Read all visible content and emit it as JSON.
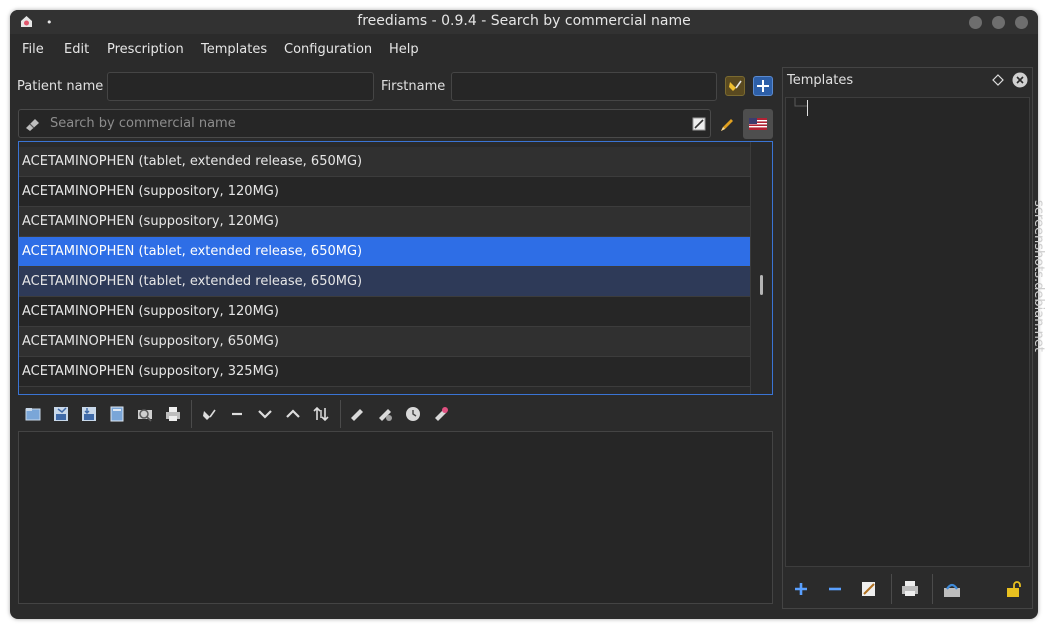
{
  "window": {
    "title": "freediams - 0.9.4 - Search by commercial name",
    "dot": "•"
  },
  "menu": [
    "File",
    "Edit",
    "Prescription",
    "Templates",
    "Configuration",
    "Help"
  ],
  "patient": {
    "name_label": "Patient name",
    "name_value": "",
    "firstname_label": "Firstname",
    "firstname_value": ""
  },
  "search": {
    "placeholder": "Search by commercial name",
    "language_flag": "us-flag-icon"
  },
  "drug_list": {
    "rows": [
      {
        "label": "ACETAMINOPHEN (tablet, extended release, 650MG)",
        "state": "normal"
      },
      {
        "label": "ACETAMINOPHEN (suppository, 120MG)",
        "state": "normal"
      },
      {
        "label": "ACETAMINOPHEN (suppository, 120MG)",
        "state": "normal"
      },
      {
        "label": "ACETAMINOPHEN (tablet, extended release, 650MG)",
        "state": "selected"
      },
      {
        "label": "ACETAMINOPHEN (tablet, extended release, 650MG)",
        "state": "hover"
      },
      {
        "label": "ACETAMINOPHEN (suppository, 120MG)",
        "state": "normal"
      },
      {
        "label": "ACETAMINOPHEN (suppository, 650MG)",
        "state": "normal"
      },
      {
        "label": "ACETAMINOPHEN (suppository, 325MG)",
        "state": "normal"
      }
    ]
  },
  "prescription_toolbar": {
    "icons": [
      "open-icon",
      "save-icon",
      "save-as-icon",
      "book-icon",
      "preview-icon",
      "print-icon",
      "clear-icon",
      "remove-icon",
      "move-down-icon",
      "move-up-icon",
      "sort-icon",
      "drug-info-icon",
      "interactions-icon",
      "clock-icon",
      "edit-rx-icon"
    ]
  },
  "templates_panel": {
    "title": "Templates",
    "toolbar_icons": [
      "add-icon",
      "remove-icon",
      "edit-icon",
      "print-icon",
      "save-icon",
      "unlock-icon"
    ]
  },
  "watermark": "screenshots.debian.net",
  "colors": {
    "selection": "#2e6ee6",
    "hover_row": "#2e3a58",
    "focus_border": "#3a74d4",
    "window_bg": "#2b2b2b"
  }
}
